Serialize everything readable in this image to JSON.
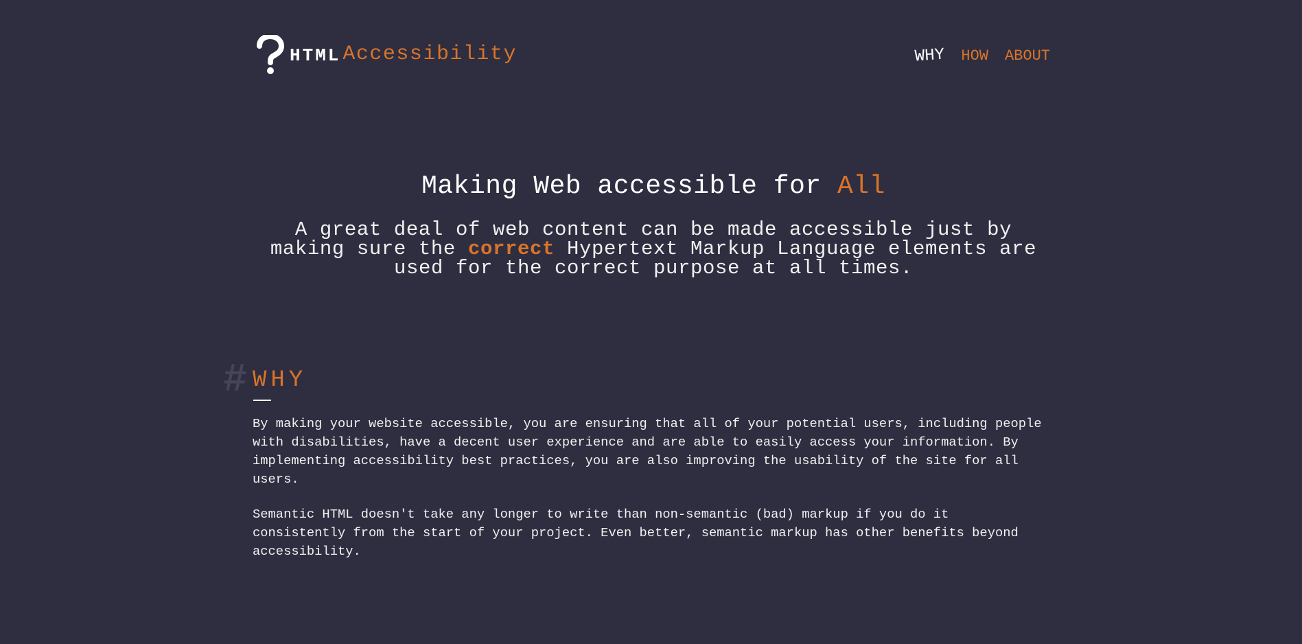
{
  "header": {
    "logo_icon": "question-mark-icon",
    "logo_html": "HTML",
    "logo_accent": "Accessibility",
    "nav": [
      {
        "label": "WHY",
        "active": true
      },
      {
        "label": "HOW",
        "active": false
      },
      {
        "label": "ABOUT",
        "active": false
      }
    ]
  },
  "hero": {
    "title_main": "Making Web accessible for ",
    "title_accent": "All",
    "lead_before": "A great deal of web content can be made accessible just by making sure the ",
    "lead_strong": "correct",
    "lead_after": " Hypertext Markup Language elements are used for the correct purpose at all times."
  },
  "why": {
    "hash": "#",
    "title": "WHY",
    "paragraphs": [
      "By making your website accessible, you are ensuring that all of your potential users, including people with disabilities, have a decent user experience and are able to easily access your information. By implementing accessibility best practices, you are also improving the usability of the site for all users.",
      "Semantic HTML doesn't take any longer to write than non-semantic (bad) markup if you do it consistently from the start of your project. Even better, semantic markup has other benefits beyond accessibility."
    ]
  },
  "colors": {
    "background": "#2f2e40",
    "accent": "#d8742a",
    "text": "#f2f2f2",
    "hash": "#454458"
  }
}
